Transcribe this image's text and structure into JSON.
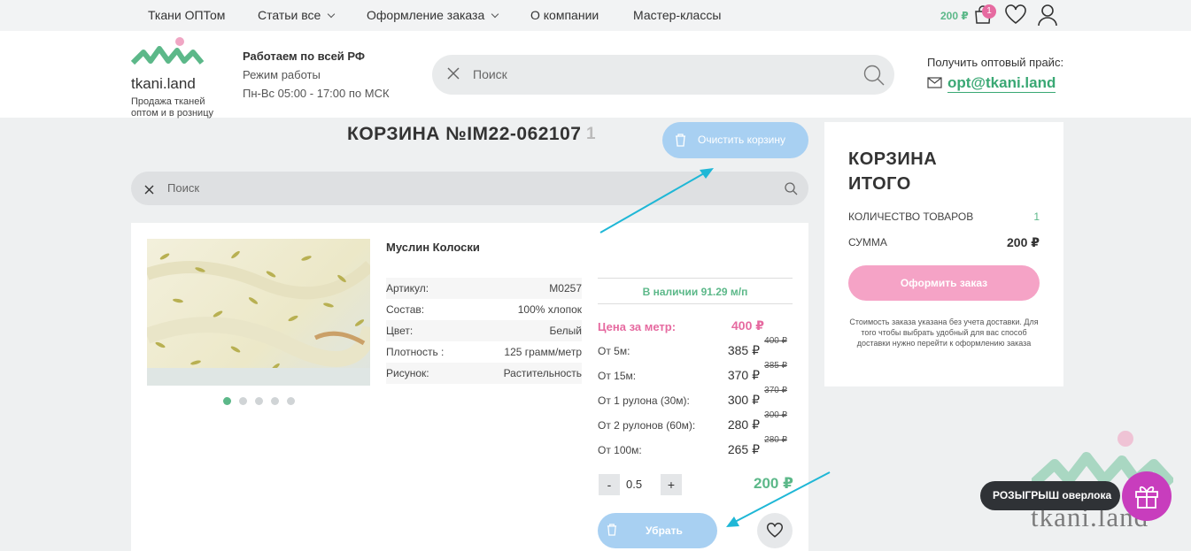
{
  "topnav": {
    "items": [
      {
        "label": "Ткани ОПТом",
        "dropdown": false
      },
      {
        "label": "Статьи все",
        "dropdown": true
      },
      {
        "label": "Оформление заказа",
        "dropdown": true
      },
      {
        "label": "О компании",
        "dropdown": false
      },
      {
        "label": "Мастер-классы",
        "dropdown": false
      }
    ],
    "cart_sum": "200 ₽",
    "cart_badge": "1",
    "icons": [
      "bag-icon",
      "heart-icon",
      "user-icon"
    ]
  },
  "header": {
    "logo_name": "tkani.land",
    "logo_sub": "Продажа тканей оптом и в розницу",
    "work_title": "Работаем по всей РФ",
    "work_mode": "Режим работы",
    "work_hours": "Пн-Вс 05:00 - 17:00 по МСК",
    "search_placeholder": "Поиск",
    "price_label": "Получить оптовый прайс:",
    "email": "opt@tkani.land"
  },
  "cart": {
    "title": "КОРЗИНА №IM22-062107",
    "count": "1",
    "clear_label": "Очистить корзину",
    "search_placeholder": "Поиск"
  },
  "product": {
    "name": "Муслин Колоски",
    "photo_dots": 5,
    "active_dot": 0,
    "props": [
      {
        "label": "Артикул:",
        "value": "M0257"
      },
      {
        "label": "Состав:",
        "value": "100% хлопок"
      },
      {
        "label": "Цвет:",
        "value": "Белый"
      },
      {
        "label": "Плотность :",
        "value": "125 грамм/метр"
      },
      {
        "label": "Рисунок:",
        "value": "Растительность"
      }
    ],
    "stock": "В наличии 91.29 м/п",
    "price_head": {
      "label": "Цена за метр:",
      "value": "400 ₽"
    },
    "tiers": [
      {
        "label": "От 5м:",
        "value": "385 ₽",
        "old": "400 ₽"
      },
      {
        "label": "От 15м:",
        "value": "370 ₽",
        "old": "385 ₽"
      },
      {
        "label": "От 1 рулона (30м):",
        "value": "300 ₽",
        "old": "370 ₽"
      },
      {
        "label": "От 2 рулонов (60м):",
        "value": "280 ₽",
        "old": "300 ₽"
      },
      {
        "label": "От 100м:",
        "value": "265 ₽",
        "old": "280 ₽"
      }
    ],
    "qty_minus": "-",
    "qty": "0.5",
    "qty_plus": "+",
    "total": "200 ₽",
    "remove_label": "Убрать"
  },
  "summary": {
    "title_line1": "КОРЗИНА",
    "title_line2": "ИТОГО",
    "count_label": "КОЛИЧЕСТВО ТОВАРОВ",
    "count_value": "1",
    "sum_label": "СУММА",
    "sum_value": "200 ₽",
    "order_label": "Оформить заказ",
    "note": "Стоимость заказа указана без учета доставки. Для того чтобы выбрать удобный для вас способ доставки нужно перейти к оформлению заказа"
  },
  "promo": {
    "label": "РОЗЫГРЫШ оверлока",
    "watermark": "tkani.land"
  },
  "colors": {
    "accent_green": "#5cb889",
    "accent_pink": "#e66aa0",
    "button_blue": "#a8d0f2",
    "arrow_cyan": "#1fb7d6"
  }
}
